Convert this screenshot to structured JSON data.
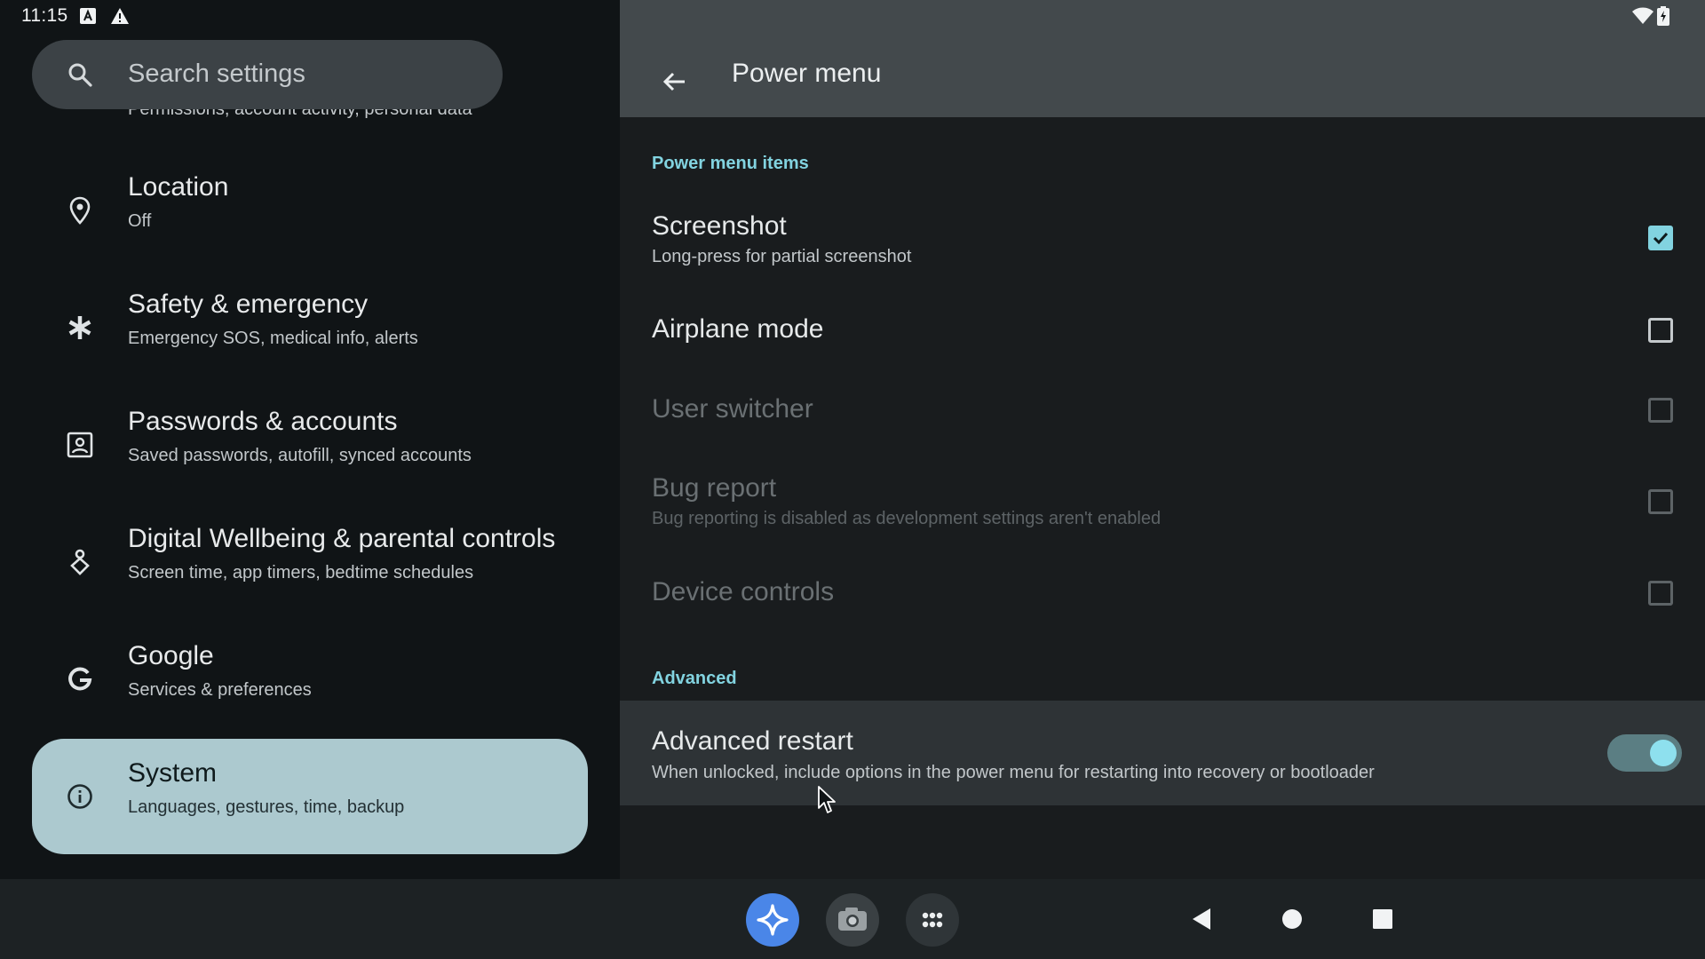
{
  "status_bar": {
    "time": "11:15",
    "icons": [
      "a-icon",
      "warning-icon",
      "wifi-icon",
      "battery-icon"
    ]
  },
  "search": {
    "placeholder": "Search settings"
  },
  "sidebar": {
    "cutoff_text": "Permissions, account activity, personal data",
    "items": [
      {
        "icon": "location-pin-icon",
        "title": "Location",
        "subtitle": "Off"
      },
      {
        "icon": "asterisk-icon",
        "title": "Safety & emergency",
        "subtitle": "Emergency SOS, medical info, alerts"
      },
      {
        "icon": "account-box-icon",
        "title": "Passwords & accounts",
        "subtitle": "Saved passwords, autofill, synced accounts"
      },
      {
        "icon": "wellbeing-icon",
        "title": "Digital Wellbeing & parental controls",
        "subtitle": "Screen time, app timers, bedtime schedules"
      },
      {
        "icon": "google-g-icon",
        "title": "Google",
        "subtitle": "Services & preferences"
      },
      {
        "icon": "info-icon",
        "title": "System",
        "subtitle": "Languages, gestures, time, backup",
        "selected": true
      }
    ]
  },
  "page": {
    "title": "Power menu"
  },
  "sections": {
    "power_menu_items": "Power menu items",
    "advanced": "Advanced"
  },
  "prefs": {
    "screenshot": {
      "title": "Screenshot",
      "subtitle": "Long-press for partial screenshot",
      "checked": true,
      "enabled": true
    },
    "airplane": {
      "title": "Airplane mode",
      "checked": false,
      "enabled": true
    },
    "user_switcher": {
      "title": "User switcher",
      "checked": false,
      "enabled": false
    },
    "bug_report": {
      "title": "Bug report",
      "subtitle": "Bug reporting is disabled as development settings aren't enabled",
      "checked": false,
      "enabled": false
    },
    "device_controls": {
      "title": "Device controls",
      "checked": false,
      "enabled": false
    },
    "advanced_restart": {
      "title": "Advanced restart",
      "subtitle": "When unlocked, include options in the power menu for restarting into recovery or bootloader",
      "toggle_on": true
    }
  },
  "taskbar": {
    "apps": [
      "assistant-icon",
      "camera-icon",
      "app-drawer-icon"
    ],
    "nav": [
      "back-nav-icon",
      "home-nav-icon",
      "recents-nav-icon"
    ]
  },
  "colors": {
    "accent": "#82d3e0",
    "selected_nav_bg": "#acc9cf",
    "app_bar_bg": "#43494c",
    "assistant_blue": "#4a86e8"
  }
}
